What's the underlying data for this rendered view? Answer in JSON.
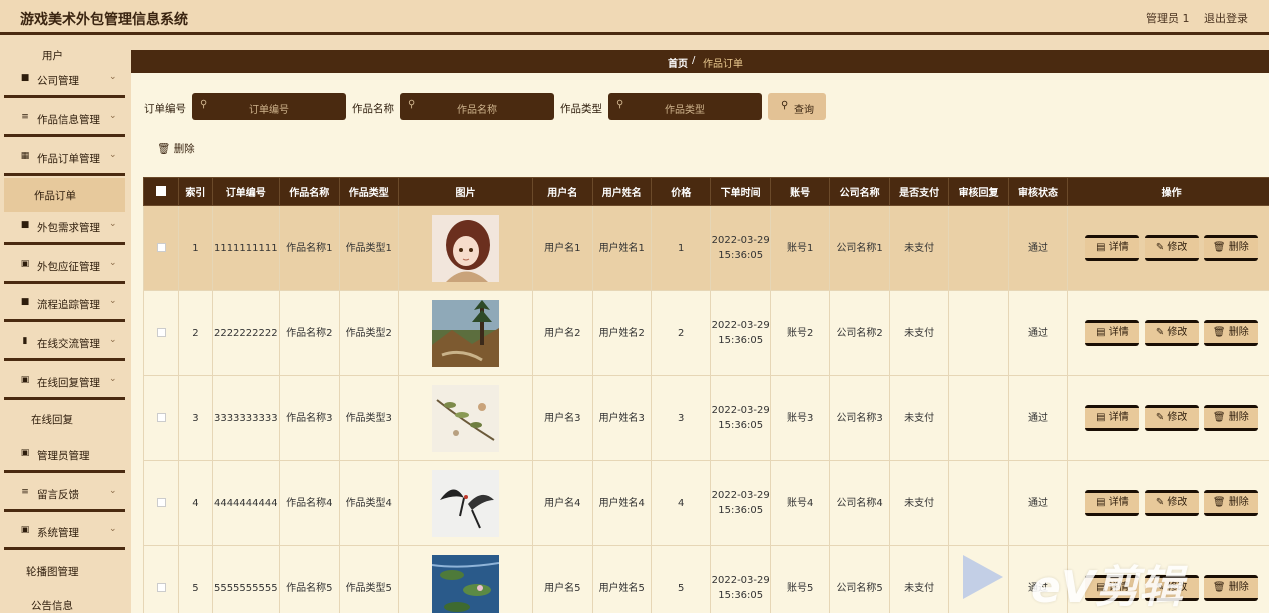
{
  "header": {
    "title": "游戏美术外包管理信息系统",
    "admin": "管理员 1",
    "logout": "退出登录"
  },
  "sidebar": {
    "top_sub": "用户",
    "items": [
      {
        "label": "公司管理",
        "icon": "book-icon"
      },
      {
        "label": "作品信息管理",
        "icon": "list-icon"
      },
      {
        "label": "作品订单管理",
        "icon": "grid-icon"
      },
      {
        "label": "外包需求管理",
        "icon": "book-icon"
      },
      {
        "label": "外包应征管理",
        "icon": "apps-icon"
      },
      {
        "label": "流程追踪管理",
        "icon": "book-icon"
      },
      {
        "label": "在线交流管理",
        "icon": "bar-chart-icon"
      },
      {
        "label": "在线回复管理",
        "icon": "apps-icon"
      },
      {
        "label": "管理员管理",
        "icon": "apps-icon"
      },
      {
        "label": "留言反馈",
        "icon": "list-icon"
      },
      {
        "label": "系统管理",
        "icon": "apps-icon"
      }
    ],
    "subs": {
      "order": "作品订单",
      "reply": "在线回复",
      "carousel": "轮播图管理",
      "notice": "公告信息"
    }
  },
  "breadcrumb": {
    "home": "首页",
    "sep": "/",
    "current": "作品订单"
  },
  "filters": {
    "order_no": {
      "label": "订单编号",
      "placeholder": "订单编号"
    },
    "work_name": {
      "label": "作品名称",
      "placeholder": "作品名称"
    },
    "work_type": {
      "label": "作品类型",
      "placeholder": "作品类型"
    },
    "query": "查询"
  },
  "delete_label": "删除",
  "table": {
    "headers": [
      "索引",
      "订单编号",
      "作品名称",
      "作品类型",
      "图片",
      "用户名",
      "用户姓名",
      "价格",
      "下单时间",
      "账号",
      "公司名称",
      "是否支付",
      "审核回复",
      "审核状态",
      "操作"
    ],
    "actions": {
      "detail": "详情",
      "edit": "修改",
      "delete": "删除"
    },
    "rows": [
      {
        "index": "1",
        "order_no": "1111111111",
        "name": "作品名称1",
        "type": "作品类型1",
        "image": "portrait-girl",
        "user": "用户名1",
        "real_name": "用户姓名1",
        "price": "1",
        "time": "2022-03-29 15:36:05",
        "account": "账号1",
        "company": "公司名称1",
        "paid": "未支付",
        "reply": "",
        "status": "通过"
      },
      {
        "index": "2",
        "order_no": "2222222222",
        "name": "作品名称2",
        "type": "作品类型2",
        "image": "forest-landscape",
        "user": "用户名2",
        "real_name": "用户姓名2",
        "price": "2",
        "time": "2022-03-29 15:36:05",
        "account": "账号2",
        "company": "公司名称2",
        "paid": "未支付",
        "reply": "",
        "status": "通过"
      },
      {
        "index": "3",
        "order_no": "3333333333",
        "name": "作品名称3",
        "type": "作品类型3",
        "image": "flower-branch",
        "user": "用户名3",
        "real_name": "用户姓名3",
        "price": "3",
        "time": "2022-03-29 15:36:05",
        "account": "账号3",
        "company": "公司名称3",
        "paid": "未支付",
        "reply": "",
        "status": "通过"
      },
      {
        "index": "4",
        "order_no": "4444444444",
        "name": "作品名称4",
        "type": "作品类型4",
        "image": "ink-cranes",
        "user": "用户名4",
        "real_name": "用户姓名4",
        "price": "4",
        "time": "2022-03-29 15:36:05",
        "account": "账号4",
        "company": "公司名称4",
        "paid": "未支付",
        "reply": "",
        "status": "通过"
      },
      {
        "index": "5",
        "order_no": "5555555555",
        "name": "作品名称5",
        "type": "作品类型5",
        "image": "water-lilies",
        "user": "用户名5",
        "real_name": "用户姓名5",
        "price": "5",
        "time": "2022-03-29 15:36:05",
        "account": "账号5",
        "company": "公司名称5",
        "paid": "未支付",
        "reply": "",
        "status": "通过"
      }
    ]
  },
  "watermark": "eV剪辑",
  "colors": {
    "header_bar": "#4a2a10",
    "background": "#f1dcbb",
    "panel": "#fbf5e0",
    "button": "#e8c99a"
  }
}
